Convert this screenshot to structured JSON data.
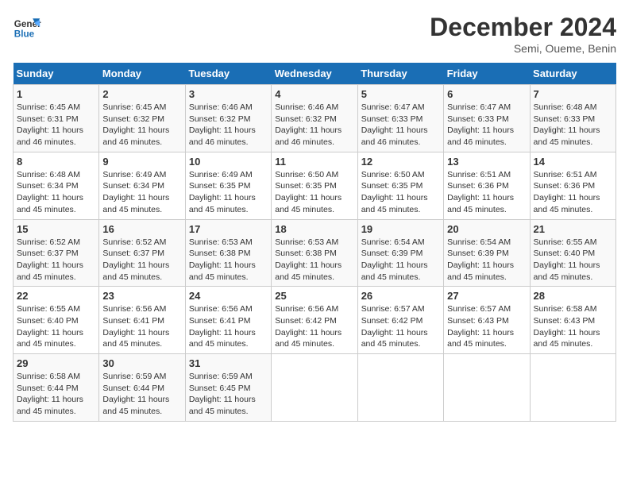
{
  "header": {
    "logo_line1": "General",
    "logo_line2": "Blue",
    "month_title": "December 2024",
    "location": "Semi, Oueme, Benin"
  },
  "weekdays": [
    "Sunday",
    "Monday",
    "Tuesday",
    "Wednesday",
    "Thursday",
    "Friday",
    "Saturday"
  ],
  "weeks": [
    [
      {
        "day": "1",
        "detail": "Sunrise: 6:45 AM\nSunset: 6:31 PM\nDaylight: 11 hours\nand 46 minutes."
      },
      {
        "day": "2",
        "detail": "Sunrise: 6:45 AM\nSunset: 6:32 PM\nDaylight: 11 hours\nand 46 minutes."
      },
      {
        "day": "3",
        "detail": "Sunrise: 6:46 AM\nSunset: 6:32 PM\nDaylight: 11 hours\nand 46 minutes."
      },
      {
        "day": "4",
        "detail": "Sunrise: 6:46 AM\nSunset: 6:32 PM\nDaylight: 11 hours\nand 46 minutes."
      },
      {
        "day": "5",
        "detail": "Sunrise: 6:47 AM\nSunset: 6:33 PM\nDaylight: 11 hours\nand 46 minutes."
      },
      {
        "day": "6",
        "detail": "Sunrise: 6:47 AM\nSunset: 6:33 PM\nDaylight: 11 hours\nand 46 minutes."
      },
      {
        "day": "7",
        "detail": "Sunrise: 6:48 AM\nSunset: 6:33 PM\nDaylight: 11 hours\nand 45 minutes."
      }
    ],
    [
      {
        "day": "8",
        "detail": "Sunrise: 6:48 AM\nSunset: 6:34 PM\nDaylight: 11 hours\nand 45 minutes."
      },
      {
        "day": "9",
        "detail": "Sunrise: 6:49 AM\nSunset: 6:34 PM\nDaylight: 11 hours\nand 45 minutes."
      },
      {
        "day": "10",
        "detail": "Sunrise: 6:49 AM\nSunset: 6:35 PM\nDaylight: 11 hours\nand 45 minutes."
      },
      {
        "day": "11",
        "detail": "Sunrise: 6:50 AM\nSunset: 6:35 PM\nDaylight: 11 hours\nand 45 minutes."
      },
      {
        "day": "12",
        "detail": "Sunrise: 6:50 AM\nSunset: 6:35 PM\nDaylight: 11 hours\nand 45 minutes."
      },
      {
        "day": "13",
        "detail": "Sunrise: 6:51 AM\nSunset: 6:36 PM\nDaylight: 11 hours\nand 45 minutes."
      },
      {
        "day": "14",
        "detail": "Sunrise: 6:51 AM\nSunset: 6:36 PM\nDaylight: 11 hours\nand 45 minutes."
      }
    ],
    [
      {
        "day": "15",
        "detail": "Sunrise: 6:52 AM\nSunset: 6:37 PM\nDaylight: 11 hours\nand 45 minutes."
      },
      {
        "day": "16",
        "detail": "Sunrise: 6:52 AM\nSunset: 6:37 PM\nDaylight: 11 hours\nand 45 minutes."
      },
      {
        "day": "17",
        "detail": "Sunrise: 6:53 AM\nSunset: 6:38 PM\nDaylight: 11 hours\nand 45 minutes."
      },
      {
        "day": "18",
        "detail": "Sunrise: 6:53 AM\nSunset: 6:38 PM\nDaylight: 11 hours\nand 45 minutes."
      },
      {
        "day": "19",
        "detail": "Sunrise: 6:54 AM\nSunset: 6:39 PM\nDaylight: 11 hours\nand 45 minutes."
      },
      {
        "day": "20",
        "detail": "Sunrise: 6:54 AM\nSunset: 6:39 PM\nDaylight: 11 hours\nand 45 minutes."
      },
      {
        "day": "21",
        "detail": "Sunrise: 6:55 AM\nSunset: 6:40 PM\nDaylight: 11 hours\nand 45 minutes."
      }
    ],
    [
      {
        "day": "22",
        "detail": "Sunrise: 6:55 AM\nSunset: 6:40 PM\nDaylight: 11 hours\nand 45 minutes."
      },
      {
        "day": "23",
        "detail": "Sunrise: 6:56 AM\nSunset: 6:41 PM\nDaylight: 11 hours\nand 45 minutes."
      },
      {
        "day": "24",
        "detail": "Sunrise: 6:56 AM\nSunset: 6:41 PM\nDaylight: 11 hours\nand 45 minutes."
      },
      {
        "day": "25",
        "detail": "Sunrise: 6:56 AM\nSunset: 6:42 PM\nDaylight: 11 hours\nand 45 minutes."
      },
      {
        "day": "26",
        "detail": "Sunrise: 6:57 AM\nSunset: 6:42 PM\nDaylight: 11 hours\nand 45 minutes."
      },
      {
        "day": "27",
        "detail": "Sunrise: 6:57 AM\nSunset: 6:43 PM\nDaylight: 11 hours\nand 45 minutes."
      },
      {
        "day": "28",
        "detail": "Sunrise: 6:58 AM\nSunset: 6:43 PM\nDaylight: 11 hours\nand 45 minutes."
      }
    ],
    [
      {
        "day": "29",
        "detail": "Sunrise: 6:58 AM\nSunset: 6:44 PM\nDaylight: 11 hours\nand 45 minutes."
      },
      {
        "day": "30",
        "detail": "Sunrise: 6:59 AM\nSunset: 6:44 PM\nDaylight: 11 hours\nand 45 minutes."
      },
      {
        "day": "31",
        "detail": "Sunrise: 6:59 AM\nSunset: 6:45 PM\nDaylight: 11 hours\nand 45 minutes."
      },
      {
        "day": "",
        "detail": ""
      },
      {
        "day": "",
        "detail": ""
      },
      {
        "day": "",
        "detail": ""
      },
      {
        "day": "",
        "detail": ""
      }
    ]
  ]
}
